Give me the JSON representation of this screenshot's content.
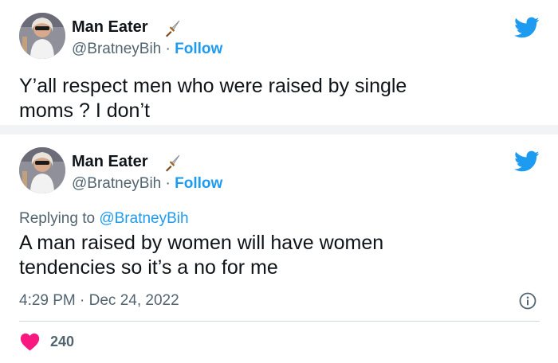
{
  "tweet1": {
    "display_name": "Man Eater",
    "name_emoji": "dagger-emoji",
    "handle": "@BratneyBih",
    "separator": "·",
    "follow_label": "Follow",
    "text_line1": "Y’all respect men who were raised by single",
    "text_line2": "moms ? I don’t"
  },
  "tweet2": {
    "display_name": "Man Eater",
    "name_emoji": "dagger-emoji",
    "handle": "@BratneyBih",
    "separator": "·",
    "follow_label": "Follow",
    "replying_prefix": "Replying to ",
    "replying_handle": "@BratneyBih",
    "text_line1": "A man raised by women will have women",
    "text_line2": "tendencies so it’s a no for me",
    "timestamp": "4:29 PM · Dec 24, 2022",
    "likes_count": "240"
  },
  "colors": {
    "twitter_blue": "#1d9bf0",
    "heart_red": "#f91880",
    "muted_text": "#536471",
    "divider": "#cfd9de"
  },
  "icons": [
    "twitter-bird-icon",
    "info-icon",
    "heart-icon",
    "dagger-emoji"
  ]
}
